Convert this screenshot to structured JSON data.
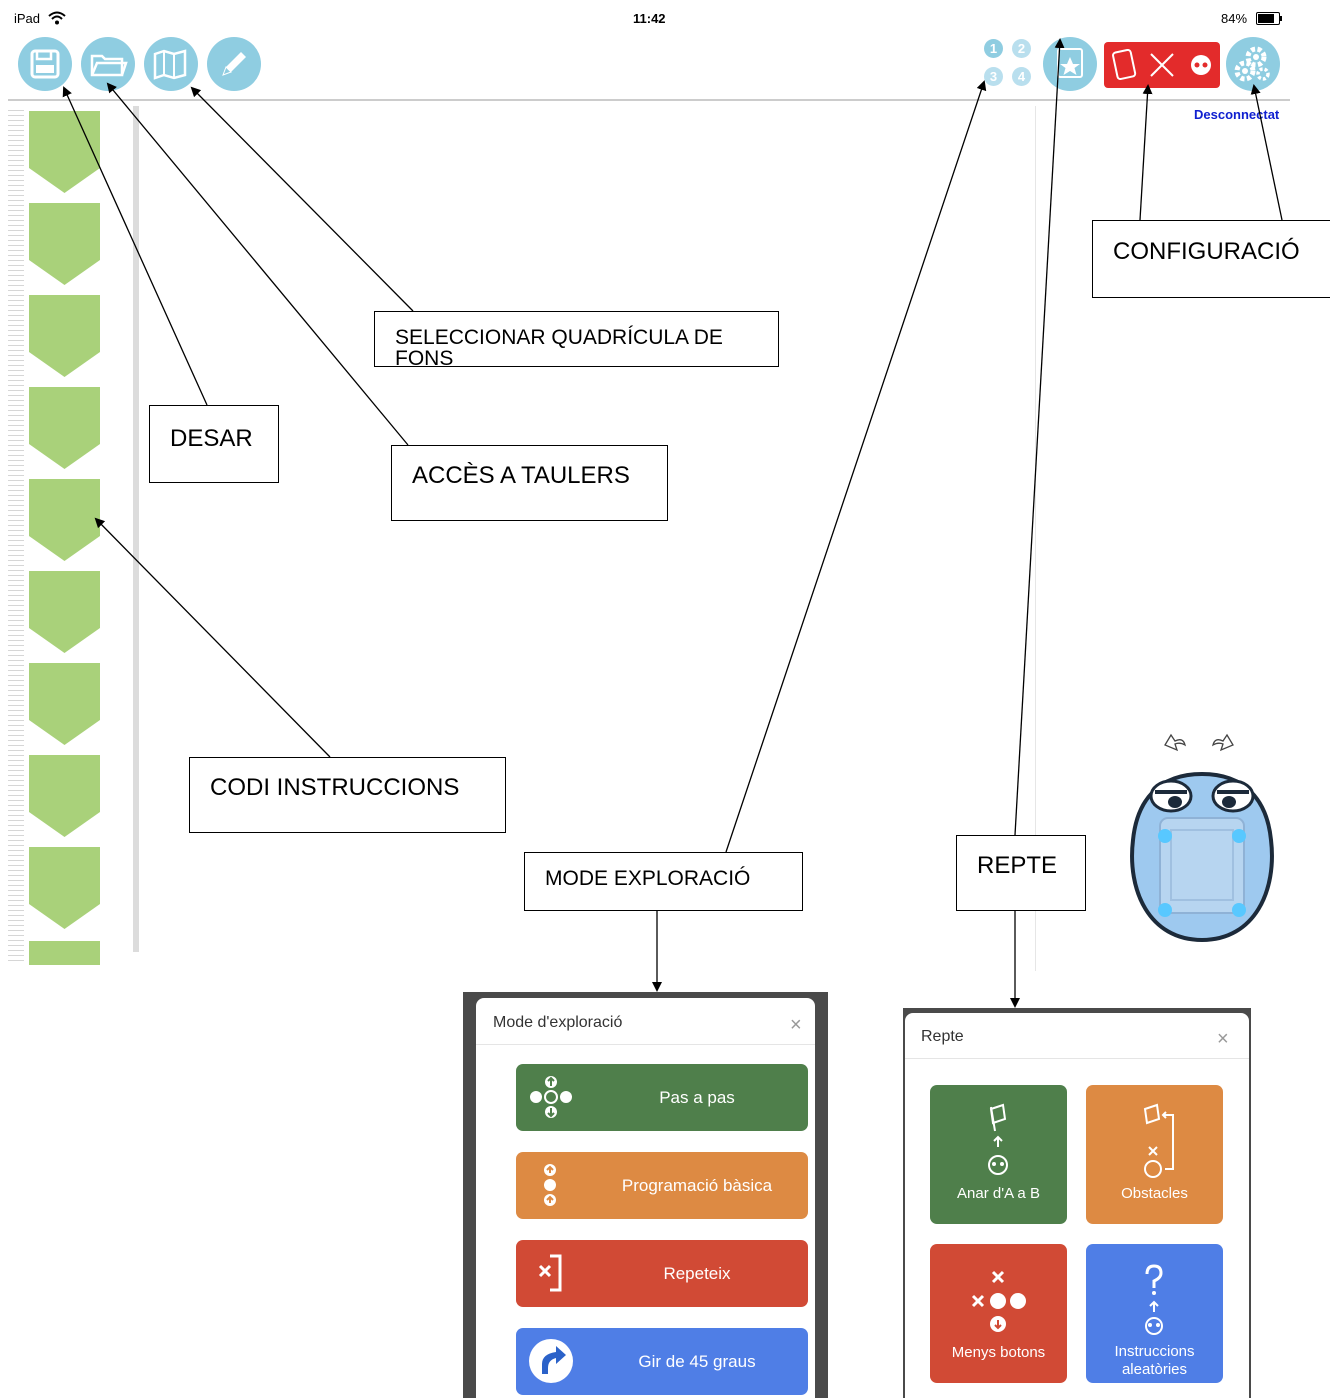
{
  "status_bar": {
    "device": "iPad",
    "time": "11:42",
    "battery": "84%"
  },
  "toolbar": {
    "left_icons": [
      "save-icon",
      "folder-icon",
      "map-icon",
      "pencil-icon"
    ],
    "mode_numbers": [
      "1",
      "2",
      "3",
      "4"
    ],
    "challenge_icon": "star-icon",
    "connection_icons": [
      "tablet-icon",
      "close-icon",
      "robot-face-icon"
    ],
    "settings_icon": "gears-icon",
    "connection_status": "Desconnectat"
  },
  "colors": {
    "toolbar_icon": "#8fcde1",
    "connection_bar": "#e32b2b",
    "code_block": "#a9d17a"
  },
  "annotations": {
    "grid": "SELECCIONAR QUADRÍCULA DE FONS",
    "save": "DESAR",
    "boards": "ACCÈS A TAULERS",
    "code": "CODI INSTRUCCIONS",
    "explore": "MODE EXPLORACIÓ",
    "challenge": "REPTE",
    "config": "CONFIGURACIÓ"
  },
  "explore_modal": {
    "title": "Mode d'exploració",
    "close": "×",
    "options": [
      "Pas a pas",
      "Programació bàsica",
      "Repeteix",
      "Gir de 45 graus"
    ]
  },
  "challenge_modal": {
    "title": "Repte",
    "close": "×",
    "options": [
      "Anar d'A a B",
      "Obstacles",
      "Menys botons",
      "Instruccions aleatòries"
    ]
  },
  "robot": {
    "rotate_icons": [
      "rotate-left-icon",
      "rotate-right-icon"
    ]
  }
}
